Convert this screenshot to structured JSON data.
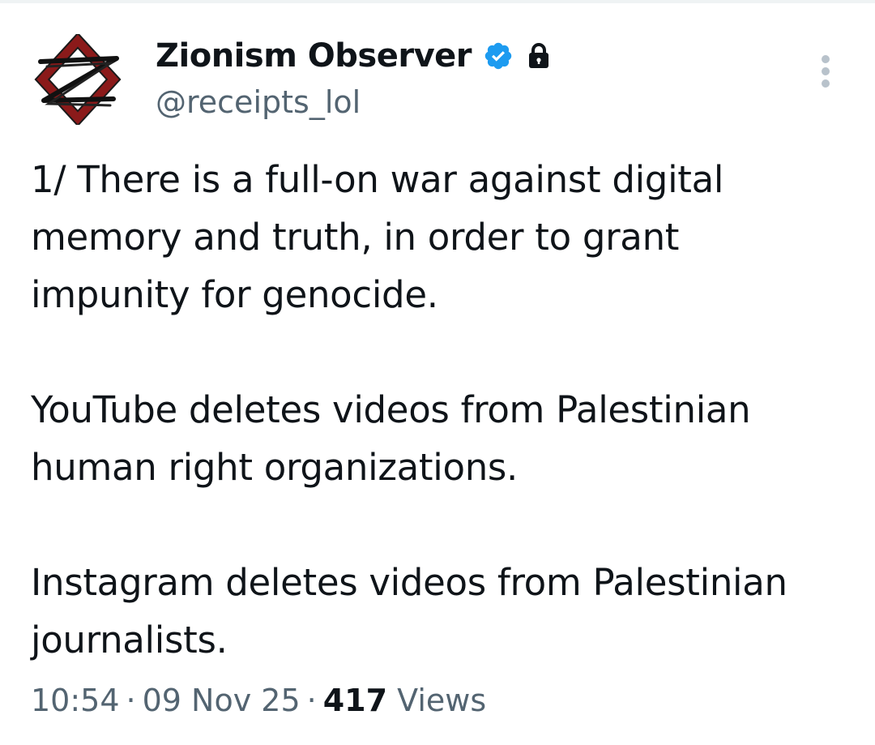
{
  "author": {
    "display_name": "Zionism Observer",
    "handle": "@receipts_lol",
    "verified": true,
    "protected": true,
    "avatar_icon": "red-diamond-z-logo"
  },
  "tweet": {
    "paragraphs": [
      "1/ There is a full-on war against digital memory and truth, in order to grant impunity for genocide.",
      "YouTube deletes videos from Palestinian human right organizations.",
      "Instagram deletes videos from Palestinian journalists."
    ]
  },
  "meta": {
    "time": "10:54",
    "separator": "·",
    "date": "09 Nov 25",
    "views_count": "417",
    "views_label": "Views"
  },
  "icons": {
    "verified": "verified-badge-icon",
    "lock": "lock-icon",
    "more": "more-options-icon"
  },
  "colors": {
    "verified_blue": "#1d9bf0",
    "secondary_text": "#536471",
    "primary_text": "#0f1419",
    "avatar_red": "#8b1a1a"
  }
}
